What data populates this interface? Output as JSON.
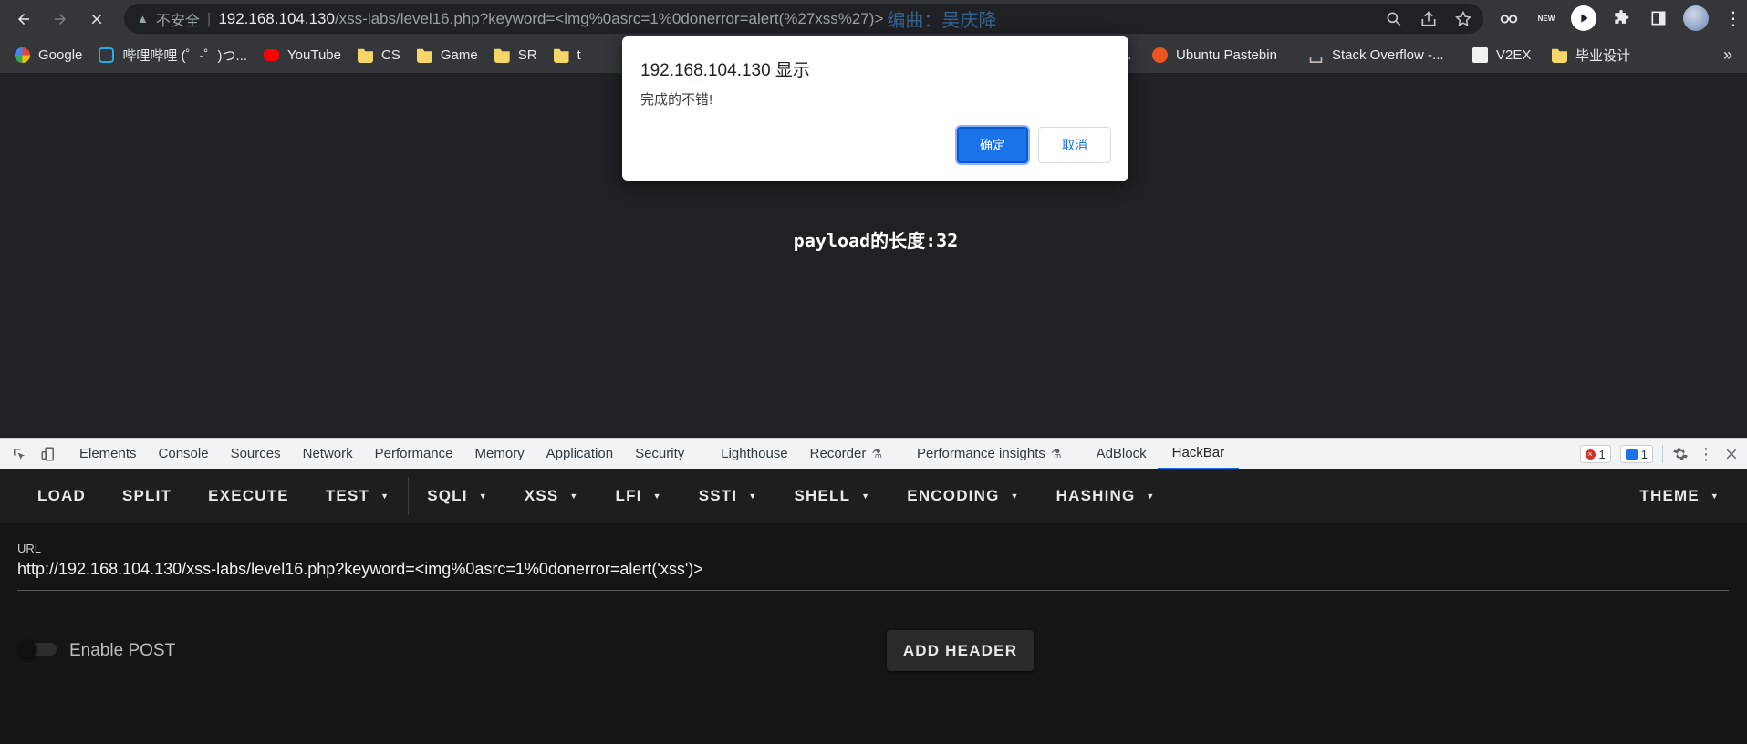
{
  "browser": {
    "address": {
      "security_label": "不安全",
      "host": "192.168.104.130",
      "path": "/xss-labs/level16.php?keyword=<img%0asrc=1%0donerror=alert(%27xss%27)>",
      "overlay_text": "编曲：吴庆降"
    },
    "extensions": {
      "new_badge": "NEW"
    }
  },
  "bookmarks": [
    {
      "label": "Google",
      "icon": "google-icon"
    },
    {
      "label": "哔哩哔哩 (゜-゜)つ...",
      "icon": "bilibili-icon"
    },
    {
      "label": "YouTube",
      "icon": "youtube-icon"
    },
    {
      "label": "CS",
      "icon": "folder-icon"
    },
    {
      "label": "Game",
      "icon": "folder-icon"
    },
    {
      "label": "SR",
      "icon": "folder-icon"
    },
    {
      "label": "t",
      "icon": "folder-icon"
    }
  ],
  "bookmarks_right": [
    {
      "label": "..",
      "icon": "none"
    },
    {
      "label": "Ubuntu Pastebin",
      "icon": "ubuntu-icon"
    },
    {
      "label": "Stack Overflow -...",
      "icon": "stackoverflow-icon"
    },
    {
      "label": "V2EX",
      "icon": "v2ex-icon"
    },
    {
      "label": "毕业设计",
      "icon": "folder-icon"
    }
  ],
  "dialog": {
    "title": "192.168.104.130 显示",
    "message": "完成的不错!",
    "ok_label": "确定",
    "cancel_label": "取消"
  },
  "page": {
    "payload_text": "payload的长度:32"
  },
  "devtools": {
    "tabs": [
      "Elements",
      "Console",
      "Sources",
      "Network",
      "Performance",
      "Memory",
      "Application",
      "Security",
      "Lighthouse",
      "Recorder",
      "Performance insights",
      "AdBlock",
      "HackBar"
    ],
    "active_tab": "HackBar",
    "error_count": "1",
    "message_count": "1"
  },
  "hackbar": {
    "menu": [
      "LOAD",
      "SPLIT",
      "EXECUTE",
      "TEST",
      "SQLI",
      "XSS",
      "LFI",
      "SSTI",
      "SHELL",
      "ENCODING",
      "HASHING"
    ],
    "theme_label": "THEME",
    "url_label": "URL",
    "url_value": "http://192.168.104.130/xss-labs/level16.php?keyword=<img%0asrc=1%0donerror=alert('xss')>",
    "enable_post_label": "Enable POST",
    "enable_post": false,
    "add_header_label": "ADD HEADER"
  },
  "colors": {
    "accent": "#1a73e8",
    "page_bg": "#202124",
    "hackbar_bg": "#151515"
  }
}
